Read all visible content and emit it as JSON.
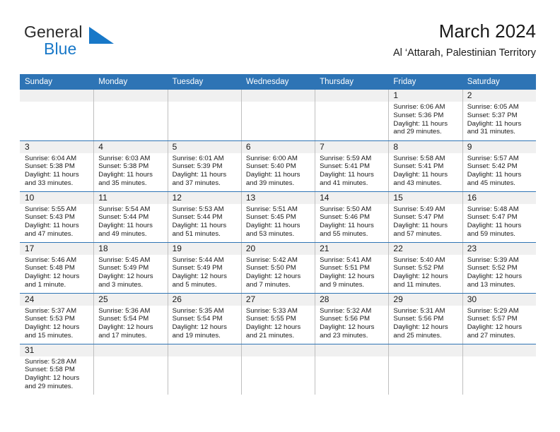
{
  "brand": {
    "name_part1": "General",
    "name_part2": "Blue",
    "flag_icon": "blue-flag-icon",
    "flag_color": "#1878C8"
  },
  "header": {
    "title": "March 2024",
    "subtitle": "Al ‘Attarah, Palestinian Territory"
  },
  "colors": {
    "header_blue": "#2E74B5",
    "daynum_strip_gray": "#F0F0F0",
    "cell_divider": "#BFBFBF",
    "text": "#1a1a1a"
  },
  "calendar": {
    "weekday_headers": [
      "Sunday",
      "Monday",
      "Tuesday",
      "Wednesday",
      "Thursday",
      "Friday",
      "Saturday"
    ],
    "weeks": [
      [
        {
          "day": "",
          "sunrise": "",
          "sunset": "",
          "daylight_line1": "",
          "daylight_line2": ""
        },
        {
          "day": "",
          "sunrise": "",
          "sunset": "",
          "daylight_line1": "",
          "daylight_line2": ""
        },
        {
          "day": "",
          "sunrise": "",
          "sunset": "",
          "daylight_line1": "",
          "daylight_line2": ""
        },
        {
          "day": "",
          "sunrise": "",
          "sunset": "",
          "daylight_line1": "",
          "daylight_line2": ""
        },
        {
          "day": "",
          "sunrise": "",
          "sunset": "",
          "daylight_line1": "",
          "daylight_line2": ""
        },
        {
          "day": "1",
          "sunrise": "Sunrise: 6:06 AM",
          "sunset": "Sunset: 5:36 PM",
          "daylight_line1": "Daylight: 11 hours",
          "daylight_line2": "and 29 minutes."
        },
        {
          "day": "2",
          "sunrise": "Sunrise: 6:05 AM",
          "sunset": "Sunset: 5:37 PM",
          "daylight_line1": "Daylight: 11 hours",
          "daylight_line2": "and 31 minutes."
        }
      ],
      [
        {
          "day": "3",
          "sunrise": "Sunrise: 6:04 AM",
          "sunset": "Sunset: 5:38 PM",
          "daylight_line1": "Daylight: 11 hours",
          "daylight_line2": "and 33 minutes."
        },
        {
          "day": "4",
          "sunrise": "Sunrise: 6:03 AM",
          "sunset": "Sunset: 5:38 PM",
          "daylight_line1": "Daylight: 11 hours",
          "daylight_line2": "and 35 minutes."
        },
        {
          "day": "5",
          "sunrise": "Sunrise: 6:01 AM",
          "sunset": "Sunset: 5:39 PM",
          "daylight_line1": "Daylight: 11 hours",
          "daylight_line2": "and 37 minutes."
        },
        {
          "day": "6",
          "sunrise": "Sunrise: 6:00 AM",
          "sunset": "Sunset: 5:40 PM",
          "daylight_line1": "Daylight: 11 hours",
          "daylight_line2": "and 39 minutes."
        },
        {
          "day": "7",
          "sunrise": "Sunrise: 5:59 AM",
          "sunset": "Sunset: 5:41 PM",
          "daylight_line1": "Daylight: 11 hours",
          "daylight_line2": "and 41 minutes."
        },
        {
          "day": "8",
          "sunrise": "Sunrise: 5:58 AM",
          "sunset": "Sunset: 5:41 PM",
          "daylight_line1": "Daylight: 11 hours",
          "daylight_line2": "and 43 minutes."
        },
        {
          "day": "9",
          "sunrise": "Sunrise: 5:57 AM",
          "sunset": "Sunset: 5:42 PM",
          "daylight_line1": "Daylight: 11 hours",
          "daylight_line2": "and 45 minutes."
        }
      ],
      [
        {
          "day": "10",
          "sunrise": "Sunrise: 5:55 AM",
          "sunset": "Sunset: 5:43 PM",
          "daylight_line1": "Daylight: 11 hours",
          "daylight_line2": "and 47 minutes."
        },
        {
          "day": "11",
          "sunrise": "Sunrise: 5:54 AM",
          "sunset": "Sunset: 5:44 PM",
          "daylight_line1": "Daylight: 11 hours",
          "daylight_line2": "and 49 minutes."
        },
        {
          "day": "12",
          "sunrise": "Sunrise: 5:53 AM",
          "sunset": "Sunset: 5:44 PM",
          "daylight_line1": "Daylight: 11 hours",
          "daylight_line2": "and 51 minutes."
        },
        {
          "day": "13",
          "sunrise": "Sunrise: 5:51 AM",
          "sunset": "Sunset: 5:45 PM",
          "daylight_line1": "Daylight: 11 hours",
          "daylight_line2": "and 53 minutes."
        },
        {
          "day": "14",
          "sunrise": "Sunrise: 5:50 AM",
          "sunset": "Sunset: 5:46 PM",
          "daylight_line1": "Daylight: 11 hours",
          "daylight_line2": "and 55 minutes."
        },
        {
          "day": "15",
          "sunrise": "Sunrise: 5:49 AM",
          "sunset": "Sunset: 5:47 PM",
          "daylight_line1": "Daylight: 11 hours",
          "daylight_line2": "and 57 minutes."
        },
        {
          "day": "16",
          "sunrise": "Sunrise: 5:48 AM",
          "sunset": "Sunset: 5:47 PM",
          "daylight_line1": "Daylight: 11 hours",
          "daylight_line2": "and 59 minutes."
        }
      ],
      [
        {
          "day": "17",
          "sunrise": "Sunrise: 5:46 AM",
          "sunset": "Sunset: 5:48 PM",
          "daylight_line1": "Daylight: 12 hours",
          "daylight_line2": "and 1 minute."
        },
        {
          "day": "18",
          "sunrise": "Sunrise: 5:45 AM",
          "sunset": "Sunset: 5:49 PM",
          "daylight_line1": "Daylight: 12 hours",
          "daylight_line2": "and 3 minutes."
        },
        {
          "day": "19",
          "sunrise": "Sunrise: 5:44 AM",
          "sunset": "Sunset: 5:49 PM",
          "daylight_line1": "Daylight: 12 hours",
          "daylight_line2": "and 5 minutes."
        },
        {
          "day": "20",
          "sunrise": "Sunrise: 5:42 AM",
          "sunset": "Sunset: 5:50 PM",
          "daylight_line1": "Daylight: 12 hours",
          "daylight_line2": "and 7 minutes."
        },
        {
          "day": "21",
          "sunrise": "Sunrise: 5:41 AM",
          "sunset": "Sunset: 5:51 PM",
          "daylight_line1": "Daylight: 12 hours",
          "daylight_line2": "and 9 minutes."
        },
        {
          "day": "22",
          "sunrise": "Sunrise: 5:40 AM",
          "sunset": "Sunset: 5:52 PM",
          "daylight_line1": "Daylight: 12 hours",
          "daylight_line2": "and 11 minutes."
        },
        {
          "day": "23",
          "sunrise": "Sunrise: 5:39 AM",
          "sunset": "Sunset: 5:52 PM",
          "daylight_line1": "Daylight: 12 hours",
          "daylight_line2": "and 13 minutes."
        }
      ],
      [
        {
          "day": "24",
          "sunrise": "Sunrise: 5:37 AM",
          "sunset": "Sunset: 5:53 PM",
          "daylight_line1": "Daylight: 12 hours",
          "daylight_line2": "and 15 minutes."
        },
        {
          "day": "25",
          "sunrise": "Sunrise: 5:36 AM",
          "sunset": "Sunset: 5:54 PM",
          "daylight_line1": "Daylight: 12 hours",
          "daylight_line2": "and 17 minutes."
        },
        {
          "day": "26",
          "sunrise": "Sunrise: 5:35 AM",
          "sunset": "Sunset: 5:54 PM",
          "daylight_line1": "Daylight: 12 hours",
          "daylight_line2": "and 19 minutes."
        },
        {
          "day": "27",
          "sunrise": "Sunrise: 5:33 AM",
          "sunset": "Sunset: 5:55 PM",
          "daylight_line1": "Daylight: 12 hours",
          "daylight_line2": "and 21 minutes."
        },
        {
          "day": "28",
          "sunrise": "Sunrise: 5:32 AM",
          "sunset": "Sunset: 5:56 PM",
          "daylight_line1": "Daylight: 12 hours",
          "daylight_line2": "and 23 minutes."
        },
        {
          "day": "29",
          "sunrise": "Sunrise: 5:31 AM",
          "sunset": "Sunset: 5:56 PM",
          "daylight_line1": "Daylight: 12 hours",
          "daylight_line2": "and 25 minutes."
        },
        {
          "day": "30",
          "sunrise": "Sunrise: 5:29 AM",
          "sunset": "Sunset: 5:57 PM",
          "daylight_line1": "Daylight: 12 hours",
          "daylight_line2": "and 27 minutes."
        }
      ],
      [
        {
          "day": "31",
          "sunrise": "Sunrise: 5:28 AM",
          "sunset": "Sunset: 5:58 PM",
          "daylight_line1": "Daylight: 12 hours",
          "daylight_line2": "and 29 minutes."
        },
        {
          "day": "",
          "sunrise": "",
          "sunset": "",
          "daylight_line1": "",
          "daylight_line2": ""
        },
        {
          "day": "",
          "sunrise": "",
          "sunset": "",
          "daylight_line1": "",
          "daylight_line2": ""
        },
        {
          "day": "",
          "sunrise": "",
          "sunset": "",
          "daylight_line1": "",
          "daylight_line2": ""
        },
        {
          "day": "",
          "sunrise": "",
          "sunset": "",
          "daylight_line1": "",
          "daylight_line2": ""
        },
        {
          "day": "",
          "sunrise": "",
          "sunset": "",
          "daylight_line1": "",
          "daylight_line2": ""
        },
        {
          "day": "",
          "sunrise": "",
          "sunset": "",
          "daylight_line1": "",
          "daylight_line2": ""
        }
      ]
    ]
  }
}
